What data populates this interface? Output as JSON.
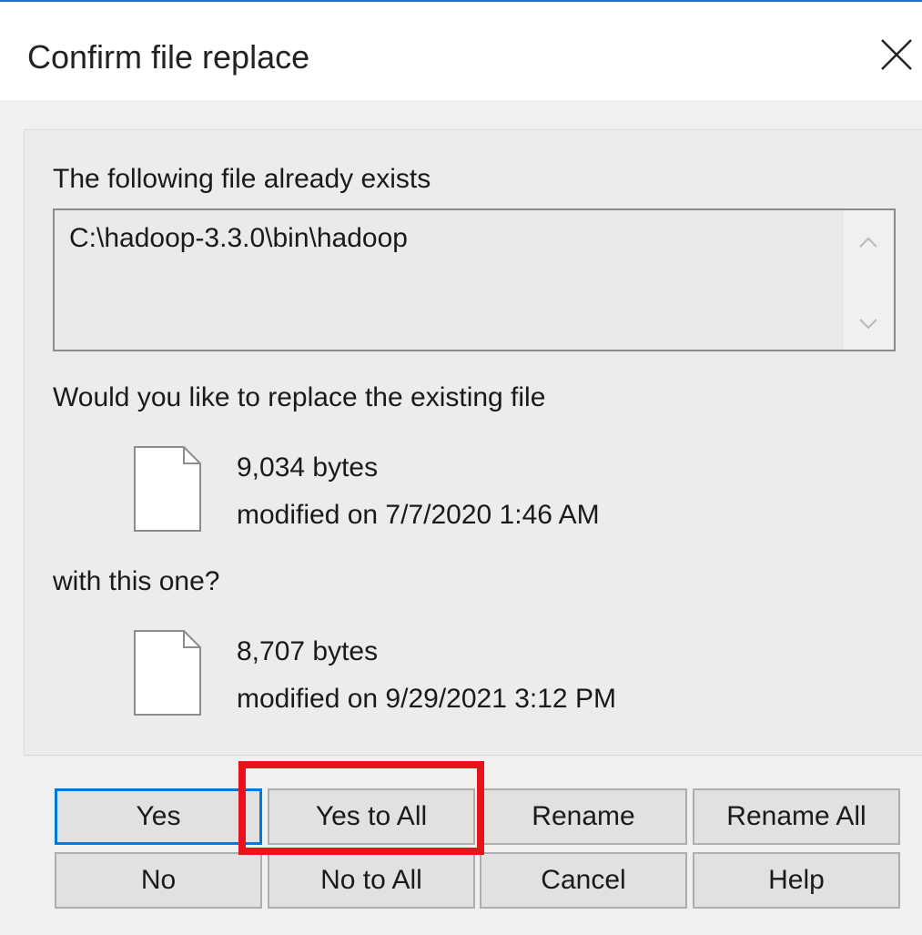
{
  "dialog": {
    "title": "Confirm file replace",
    "close_icon": "close-icon"
  },
  "message": {
    "exists_label": "The following file already exists",
    "path": "C:\\hadoop-3.3.0\\bin\\hadoop",
    "replace_question": "Would you like to replace the existing file",
    "with_label": "with this one?"
  },
  "existing_file": {
    "icon": "file-icon",
    "size": "9,034 bytes",
    "modified": "modified on 7/7/2020 1:46 AM"
  },
  "new_file": {
    "icon": "file-icon",
    "size": "8,707 bytes",
    "modified": "modified on 9/29/2021 3:12 PM"
  },
  "buttons": {
    "yes": "Yes",
    "yes_to_all": "Yes to All",
    "rename": "Rename",
    "rename_all": "Rename All",
    "no": "No",
    "no_to_all": "No to All",
    "cancel": "Cancel",
    "help": "Help"
  },
  "colors": {
    "accent": "#0078d7",
    "highlight": "#e8121b",
    "title_border": "#1f6fc5"
  }
}
